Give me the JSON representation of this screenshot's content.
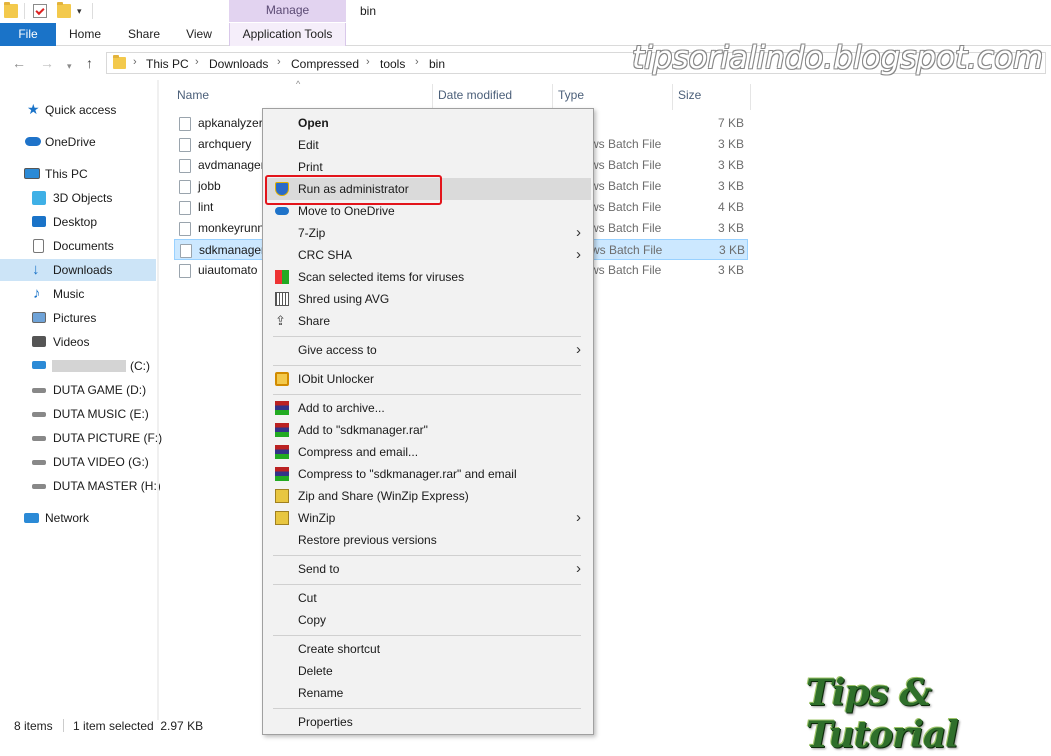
{
  "window": {
    "title": "bin",
    "context_tab": "Manage"
  },
  "ribbon": {
    "tabs": [
      "File",
      "Home",
      "Share",
      "View",
      "Application Tools"
    ]
  },
  "address": {
    "path": [
      "This PC",
      "Downloads",
      "Compressed",
      "tools",
      "bin"
    ]
  },
  "watermark": "tipsorialindo.blogspot.com",
  "sidebar": {
    "items": [
      {
        "label": "Quick access",
        "icon": "star-icon"
      },
      {
        "label": "OneDrive",
        "icon": "cloud-icon"
      },
      {
        "label": "This PC",
        "icon": "computer-icon"
      },
      {
        "label": "3D Objects",
        "icon": "cube-icon"
      },
      {
        "label": "Desktop",
        "icon": "desktop-icon"
      },
      {
        "label": "Documents",
        "icon": "document-icon"
      },
      {
        "label": "Downloads",
        "icon": "download-icon",
        "selected": true
      },
      {
        "label": "Music",
        "icon": "music-icon"
      },
      {
        "label": "Pictures",
        "icon": "picture-icon"
      },
      {
        "label": "Videos",
        "icon": "video-icon"
      },
      {
        "label": "(C:)",
        "icon": "drive-icon"
      },
      {
        "label": "DUTA GAME (D:)",
        "icon": "drive-icon"
      },
      {
        "label": "DUTA MUSIC (E:)",
        "icon": "drive-icon"
      },
      {
        "label": "DUTA PICTURE (F:)",
        "icon": "drive-icon"
      },
      {
        "label": "DUTA VIDEO (G:)",
        "icon": "drive-icon"
      },
      {
        "label": "DUTA MASTER (H:)",
        "icon": "drive-icon"
      },
      {
        "label": "Network",
        "icon": "network-icon"
      }
    ]
  },
  "filelist": {
    "columns": [
      "Name",
      "Date modified",
      "Type",
      "Size"
    ],
    "rows": [
      {
        "name": "apkanalyzer",
        "type": "",
        "size": "7 KB"
      },
      {
        "name": "archquery",
        "type": "ws Batch File",
        "size": "3 KB"
      },
      {
        "name": "avdmanager",
        "type": "ws Batch File",
        "size": "3 KB"
      },
      {
        "name": "jobb",
        "type": "ws Batch File",
        "size": "3 KB"
      },
      {
        "name": "lint",
        "type": "ws Batch File",
        "size": "4 KB"
      },
      {
        "name": "monkeyrunn",
        "type": "ws Batch File",
        "size": "3 KB"
      },
      {
        "name": "sdkmanager",
        "type": "ws Batch File",
        "size": "3 KB",
        "selected": true
      },
      {
        "name": "uiautomato",
        "type": "ws Batch File",
        "size": "3 KB"
      }
    ]
  },
  "status": {
    "count": "8 items",
    "selection": "1 item selected  2.97 KB"
  },
  "context_menu": {
    "open": "Open",
    "edit": "Edit",
    "print": "Print",
    "run_admin": "Run as administrator",
    "move_onedrive": "Move to OneDrive",
    "seven_zip": "7-Zip",
    "crc_sha": "CRC SHA",
    "scan_viruses": "Scan selected items for viruses",
    "shred_avg": "Shred using AVG",
    "share": "Share",
    "give_access": "Give access to",
    "iobit": "IObit Unlocker",
    "add_archive": "Add to archive...",
    "add_rar": "Add to \"sdkmanager.rar\"",
    "compress_email": "Compress and email...",
    "compress_rar_email": "Compress to \"sdkmanager.rar\" and email",
    "zip_share": "Zip and Share (WinZip Express)",
    "winzip": "WinZip",
    "restore": "Restore previous versions",
    "send_to": "Send to",
    "cut": "Cut",
    "copy": "Copy",
    "create_shortcut": "Create shortcut",
    "delete": "Delete",
    "rename": "Rename",
    "properties": "Properties"
  },
  "brand": "Tips & Tutorial",
  "colors": {
    "accent": "#1a73c8",
    "selection": "#cce8ff",
    "highlight_box": "#e3141b"
  }
}
